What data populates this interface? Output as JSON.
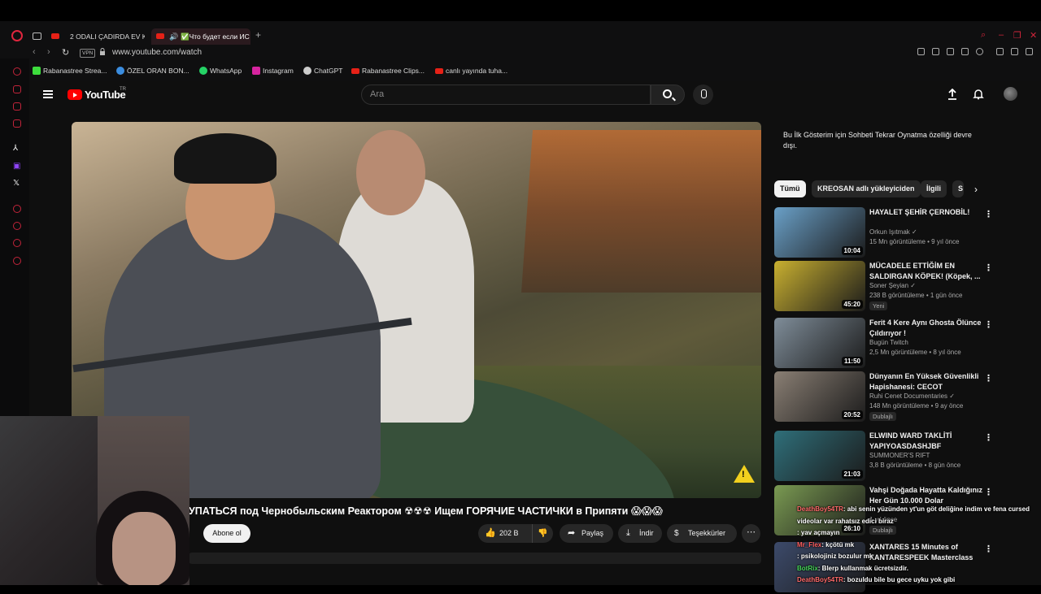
{
  "browser": {
    "tabs": [
      {
        "label": "2 ODALI ÇADIRDA EV KO"
      },
      {
        "label": "✅Что будет если ИС"
      }
    ],
    "address": {
      "vpn": "VPN",
      "url": "www.youtube.com/watch"
    },
    "bookmarks": [
      {
        "label": "Rabanastree Strea...",
        "color": "#3ddc3d"
      },
      {
        "label": "ÖZEL ORAN BON...",
        "color": "#3b8de0"
      },
      {
        "label": "WhatsApp",
        "color": "#25d366"
      },
      {
        "label": "Instagram",
        "color": "#d6249f"
      },
      {
        "label": "ChatGPT",
        "color": "#cccccc"
      },
      {
        "label": "Rabanastree Clips...",
        "color": "#e62117"
      },
      {
        "label": "canlı yayında tuha...",
        "color": "#e62117"
      }
    ]
  },
  "youtube": {
    "logo_text": "YouTube",
    "country": "TR",
    "search_placeholder": "Ara",
    "video_title": "УПАТЬСЯ под Чернобыльским Реактором ☢☢☢ Ищем ГОРЯЧИЕ ЧАСТИЧКИ в Припяти 😱😱😱",
    "subscribe": "Abone ol",
    "likes": "202 B",
    "share": "Paylaş",
    "download": "İndir",
    "thanks": "Teşekkürler",
    "premiere_message": "Bu İlk Gösterim için Sohbeti Tekrar Oynatma özelliği devre dışı.",
    "chips": [
      {
        "label": "Tümü"
      },
      {
        "label": "KREOSAN adlı yükleyiciden"
      },
      {
        "label": "İlgili"
      },
      {
        "label": "S"
      }
    ],
    "recommendations": [
      {
        "title": "HAYALET ŞEHİR ÇERNOBİL!",
        "channel": "Orkun Işıtmak ✓",
        "meta": "15 Mn görüntüleme • 9 yıl önce",
        "duration": "10:04",
        "badge": "",
        "thumb": "#6aa0c8"
      },
      {
        "title": "MÜCADELE ETTİĞİM EN SALDIRGAN KÖPEK! (Köpek, ...",
        "channel": "Soner Şeyian ✓",
        "meta": "238 B görüntüleme • 1 gün önce",
        "duration": "45:20",
        "badge": "Yeni",
        "thumb": "#c9b030"
      },
      {
        "title": "Ferit 4 Kere Aynı Ghosta Ölünce Çıldırıyor !",
        "channel": "Bugün Twitch",
        "meta": "2,5 Mn görüntüleme • 8 yıl önce",
        "duration": "11:50",
        "badge": "",
        "thumb": "#7f8d99"
      },
      {
        "title": "Dünyanın En Yüksek Güvenlikli Hapishanesi: CECOT (Şeytanla...",
        "channel": "Ruhi Cenet Documentaries ✓",
        "meta": "148 Mn görüntüleme • 9 ay önce",
        "duration": "20:52",
        "badge": "Dublajlı",
        "thumb": "#8a7f74"
      },
      {
        "title": "ELWIND WARD TAKLİTİ YAPIYOASDASHJBF (BONUSU...",
        "channel": "SUMMONER'S RIFT",
        "meta": "3,8 B görüntüleme • 8 gün önce",
        "duration": "21:03",
        "badge": "",
        "thumb": "#2f6f7a"
      },
      {
        "title": "Vahşi Doğada Hayatta Kaldığınız Her Gün 10.000 Dolar",
        "channel": "",
        "meta": "1 yıl önce",
        "duration": "26:10",
        "badge": "Dublajlı",
        "thumb": "#7a9a52"
      },
      {
        "title": "XANTARES 15 Minutes of XANTARESPEEK Masterclass",
        "channel": "",
        "meta": "",
        "duration": "",
        "badge": "",
        "thumb": "#3c4a6a"
      }
    ]
  },
  "chat": [
    {
      "name": "DeathBoy54TR",
      "name_color": "#ff6a6a",
      "text": ": abi senin yüzünden yt'un göt deliğine indim ve fena cursed videolar var rahatsız edici biraz"
    },
    {
      "name": "",
      "name_color": "#ff6a6a",
      "text": ": yav açmayın"
    },
    {
      "name": "Mr_Flex",
      "name_color": "#ff5e5e",
      "text": ": kçötü mk"
    },
    {
      "name": "",
      "name_color": "#6ab0ff",
      "text": ": psikolojiniz bozulur mk"
    },
    {
      "name": "BotRix",
      "name_color": "#48d85c",
      "text": ": Blerp kullanmak ücretsizdir."
    },
    {
      "name": "DeathBoy54TR",
      "name_color": "#ff6a6a",
      "text": ": bozuldu bile bu gece uyku yok gibi"
    }
  ]
}
